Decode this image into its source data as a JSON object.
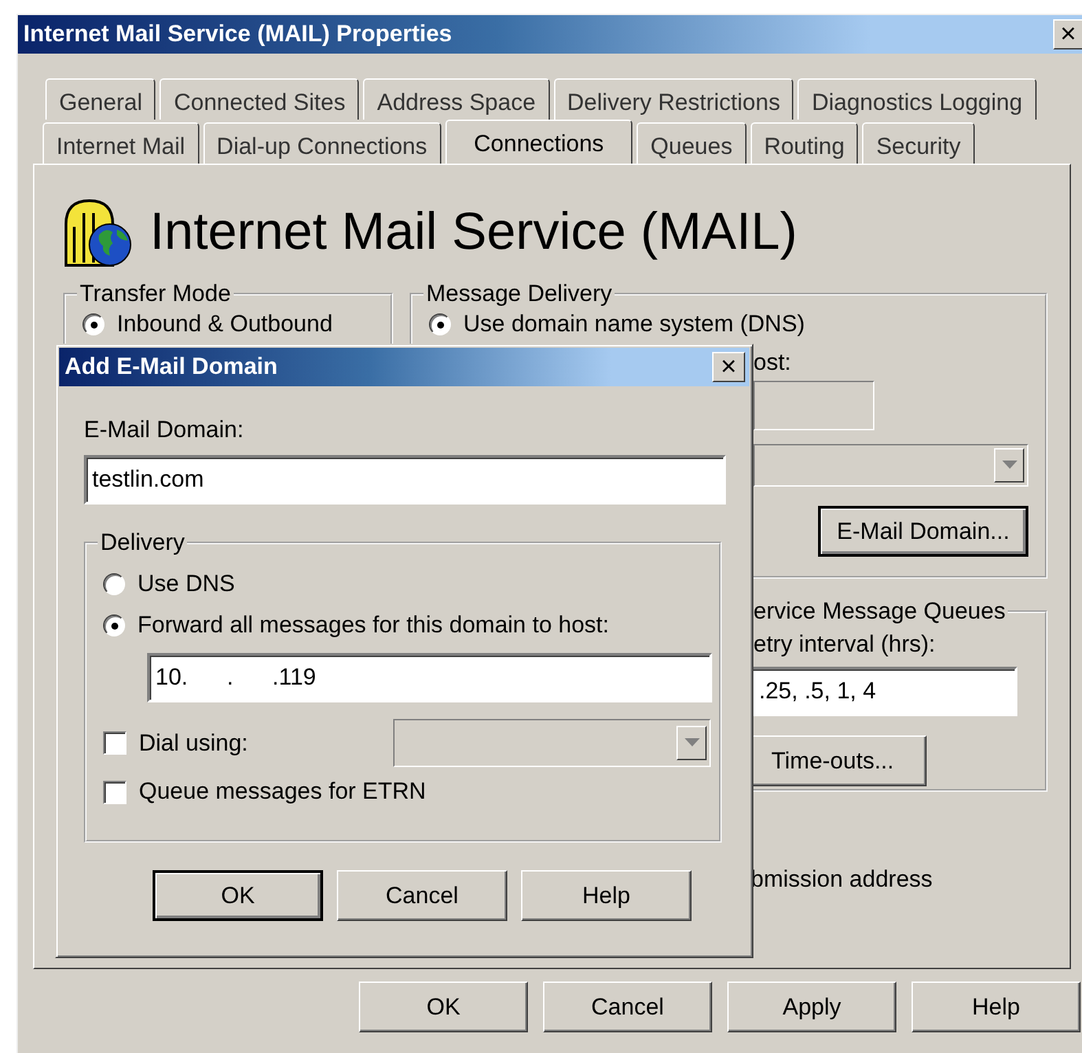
{
  "window": {
    "title": "Internet Mail Service (MAIL) Properties",
    "close": "×"
  },
  "tab_rows": [
    {
      "tabs": [
        {
          "label": "General",
          "selected": false
        },
        {
          "label": "Connected Sites",
          "selected": false
        },
        {
          "label": "Address Space",
          "selected": false
        },
        {
          "label": "Delivery Restrictions",
          "selected": false
        },
        {
          "label": "Diagnostics Logging",
          "selected": false
        }
      ]
    },
    {
      "tabs": [
        {
          "label": "Internet Mail",
          "selected": false
        },
        {
          "label": "Dial-up Connections",
          "selected": false
        },
        {
          "label": "Connections",
          "selected": true
        },
        {
          "label": "Queues",
          "selected": false
        },
        {
          "label": "Routing",
          "selected": false
        },
        {
          "label": "Security",
          "selected": false
        }
      ]
    }
  ],
  "header": {
    "title": "Internet Mail Service (MAIL)"
  },
  "transfer_mode": {
    "title": "Transfer Mode",
    "options": [
      {
        "label": "Inbound & Outbound",
        "selected": true
      }
    ]
  },
  "message_delivery": {
    "title": "Message Delivery",
    "options": [
      {
        "label": "Use domain name system (DNS)",
        "selected": true
      }
    ],
    "host_label": "ost:",
    "button": {
      "label": "E-Mail Domain...",
      "default": true
    }
  },
  "queues": {
    "title": "ervice Message Queues",
    "retry_label": "etry interval (hrs):",
    "retry_value": ".25, .5, 1, 4",
    "button": {
      "label": "Time-outs...",
      "default": false
    }
  },
  "submission_label": "bmission address",
  "buttons": [
    {
      "label": "OK",
      "default": false
    },
    {
      "label": "Cancel",
      "default": false
    },
    {
      "label": "Apply",
      "default": false
    },
    {
      "label": "Help",
      "default": false
    }
  ],
  "dialog": {
    "title": "Add E-Mail Domain",
    "close": "×",
    "domain_label": "E-Mail Domain:",
    "domain_value": "testlin.com",
    "delivery": {
      "title": "Delivery",
      "options": [
        {
          "label": "Use DNS",
          "selected": false
        },
        {
          "label": "Forward all messages for this domain to host:",
          "selected": true
        }
      ],
      "host_value": "10.      .      .119"
    },
    "checks": [
      {
        "label": "Dial using:",
        "checked": false,
        "kind": "dropdown"
      },
      {
        "label": "Queue messages for ETRN",
        "checked": false,
        "kind": "plain"
      }
    ],
    "buttons": [
      {
        "label": "OK",
        "default": true
      },
      {
        "label": "Cancel",
        "default": false
      },
      {
        "label": "Help",
        "default": false
      }
    ]
  }
}
